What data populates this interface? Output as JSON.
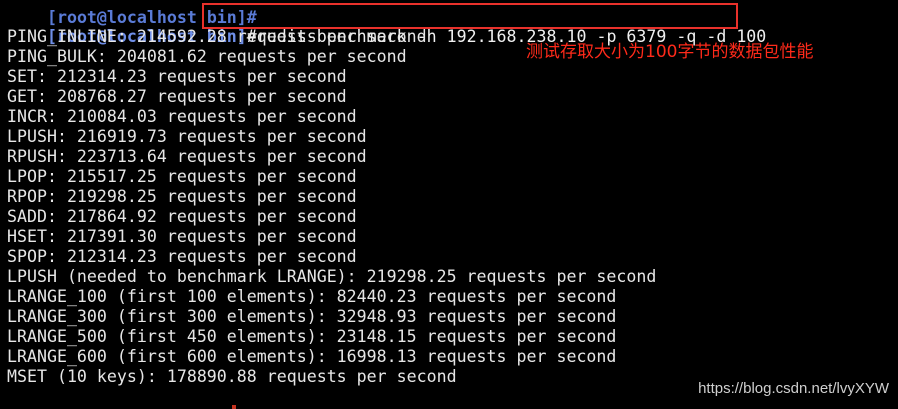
{
  "terminal": {
    "prev_prompt": "[root@localhost bin]#",
    "prompt": "[root@localhost bin]",
    "prompt_hash": "#",
    "command": "redis-benchmark -h 192.168.238.10 -p 6379 -q -d 100",
    "output": [
      "PING_INLINE: 214592.28 requests per second",
      "PING_BULK: 204081.62 requests per second",
      "SET: 212314.23 requests per second",
      "GET: 208768.27 requests per second",
      "INCR: 210084.03 requests per second",
      "LPUSH: 216919.73 requests per second",
      "RPUSH: 223713.64 requests per second",
      "LPOP: 215517.25 requests per second",
      "RPOP: 219298.25 requests per second",
      "SADD: 217864.92 requests per second",
      "HSET: 217391.30 requests per second",
      "SPOP: 212314.23 requests per second",
      "LPUSH (needed to benchmark LRANGE): 219298.25 requests per second",
      "LRANGE_100 (first 100 elements): 82440.23 requests per second",
      "LRANGE_300 (first 300 elements): 32948.93 requests per second",
      "LRANGE_500 (first 450 elements): 23148.15 requests per second",
      "LRANGE_600 (first 600 elements): 16998.13 requests per second",
      "MSET (10 keys): 178890.88 requests per second"
    ]
  },
  "annotation": {
    "text": "测试存取大小为100字节的数据包性能"
  },
  "watermark": {
    "text": "https://blog.csdn.net/lvyXYW"
  },
  "colors": {
    "background": "#000000",
    "prompt": "#6f8fe8",
    "text": "#e6e6e6",
    "highlight_border": "#e8312b",
    "annotation": "#ff2a1a"
  }
}
